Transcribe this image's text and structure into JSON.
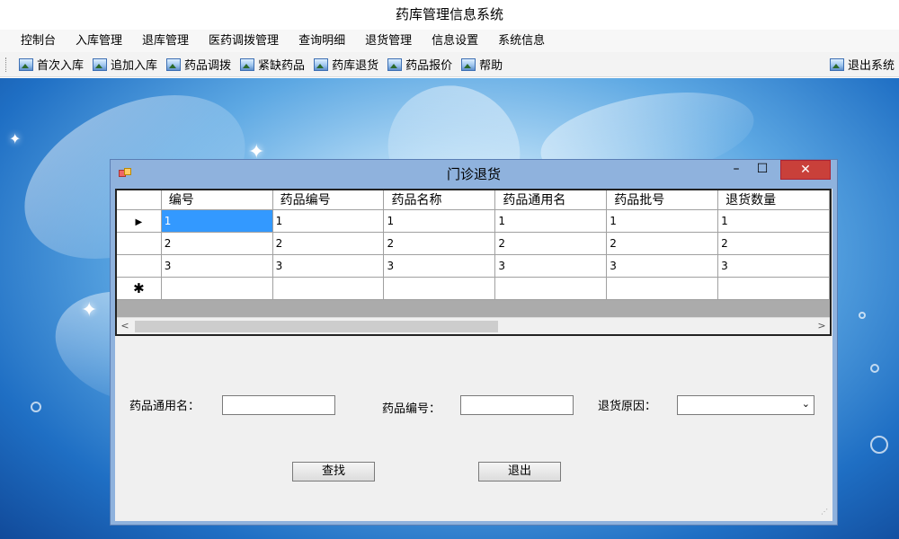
{
  "app": {
    "title": "药库管理信息系统"
  },
  "menu": [
    "控制台",
    "入库管理",
    "退库管理",
    "医药调拨管理",
    "查询明细",
    "退货管理",
    "信息设置",
    "系统信息"
  ],
  "toolbar": {
    "items": [
      "首次入库",
      "追加入库",
      "药品调拨",
      "紧缺药品",
      "药库退货",
      "药品报价",
      "帮助"
    ],
    "exit_label": "退出系统"
  },
  "dialog": {
    "title": "门诊退货",
    "min_glyph": "–",
    "max_glyph": "☐",
    "close_glyph": "✕",
    "grid": {
      "columns": [
        "编号",
        "药品编号",
        "药品名称",
        "药品通用名",
        "药品批号",
        "退货数量"
      ],
      "rows": [
        [
          "1",
          "1",
          "1",
          "1",
          "1",
          "1"
        ],
        [
          "2",
          "2",
          "2",
          "2",
          "2",
          "2"
        ],
        [
          "3",
          "3",
          "3",
          "3",
          "3",
          "3"
        ]
      ],
      "current_row_glyph": "▶",
      "new_row_glyph": "✱",
      "scroll_left_glyph": "<",
      "scroll_right_glyph": ">"
    },
    "form": {
      "generic_name_label": "药品通用名：",
      "generic_name_value": "",
      "drug_code_label": "药品编号：",
      "drug_code_value": "",
      "reason_label": "退货原因：",
      "reason_value": "",
      "reason_arrow": "⌄"
    },
    "buttons": {
      "search": "查找",
      "exit": "退出"
    }
  }
}
